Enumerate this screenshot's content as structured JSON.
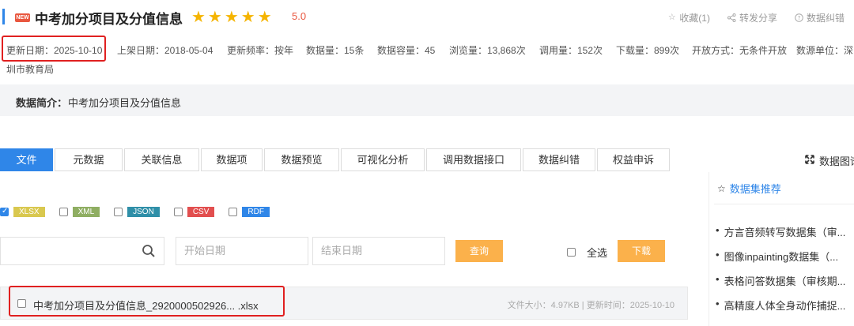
{
  "header": {
    "badge": "NEW",
    "title": "中考加分项目及分值信息",
    "stars": "★★★★★",
    "rating": "5.0",
    "actions": [
      {
        "icon": "star-outline-icon",
        "label": "收藏(1)"
      },
      {
        "icon": "share-icon",
        "label": "转发分享"
      },
      {
        "icon": "help-icon",
        "label": "数据纠错"
      }
    ]
  },
  "meta": {
    "update_date": "更新日期：2025-10-10",
    "shelf_date": "上架日期：2018-05-04",
    "frequency": "更新频率：按年",
    "data_count": "数据量：15条",
    "capacity": "数据容量：45",
    "views": "浏览量：13,868次",
    "calls": "调用量：152次",
    "downloads": "下载量：899次",
    "open_mode": "开放方式：无条件开放",
    "source_unit": "数源单位：深",
    "source_unit_cont": "圳市教育局"
  },
  "intro": {
    "label": "数据简介：",
    "text": "中考加分项目及分值信息"
  },
  "tabs": [
    {
      "label": "文件",
      "active": true
    },
    {
      "label": "元数据"
    },
    {
      "label": "关联信息"
    },
    {
      "label": "数据项"
    },
    {
      "label": "数据预览"
    },
    {
      "label": "可视化分析"
    },
    {
      "label": "调用数据接口"
    },
    {
      "label": "数据纠错"
    },
    {
      "label": "权益申诉"
    }
  ],
  "tab_right": "数据图谱",
  "formats": [
    {
      "label": "XLSX",
      "checked": true,
      "color": "#d9c84f"
    },
    {
      "label": "XML",
      "checked": false,
      "color": "#8fae62"
    },
    {
      "label": "JSON",
      "checked": false,
      "color": "#2f8fa8"
    },
    {
      "label": "CSV",
      "checked": false,
      "color": "#e24f4f"
    },
    {
      "label": "RDF",
      "checked": false,
      "color": "#2f86e8"
    }
  ],
  "search": {
    "start_placeholder": "开始日期",
    "end_placeholder": "结束日期",
    "query_label": "查询",
    "select_all": "全选",
    "download_label": "下载"
  },
  "file": {
    "name": "中考加分项目及分值信息_2920000502926... .xlsx",
    "meta": "文件大小：4.97KB | 更新时间：2025-10-10"
  },
  "sidebar": {
    "title": "数据集推荐",
    "items": [
      "方言音频转写数据集（审...",
      "图像inpainting数据集（...",
      "表格问答数据集（审核期...",
      "高精度人体全身动作捕捉..."
    ]
  }
}
